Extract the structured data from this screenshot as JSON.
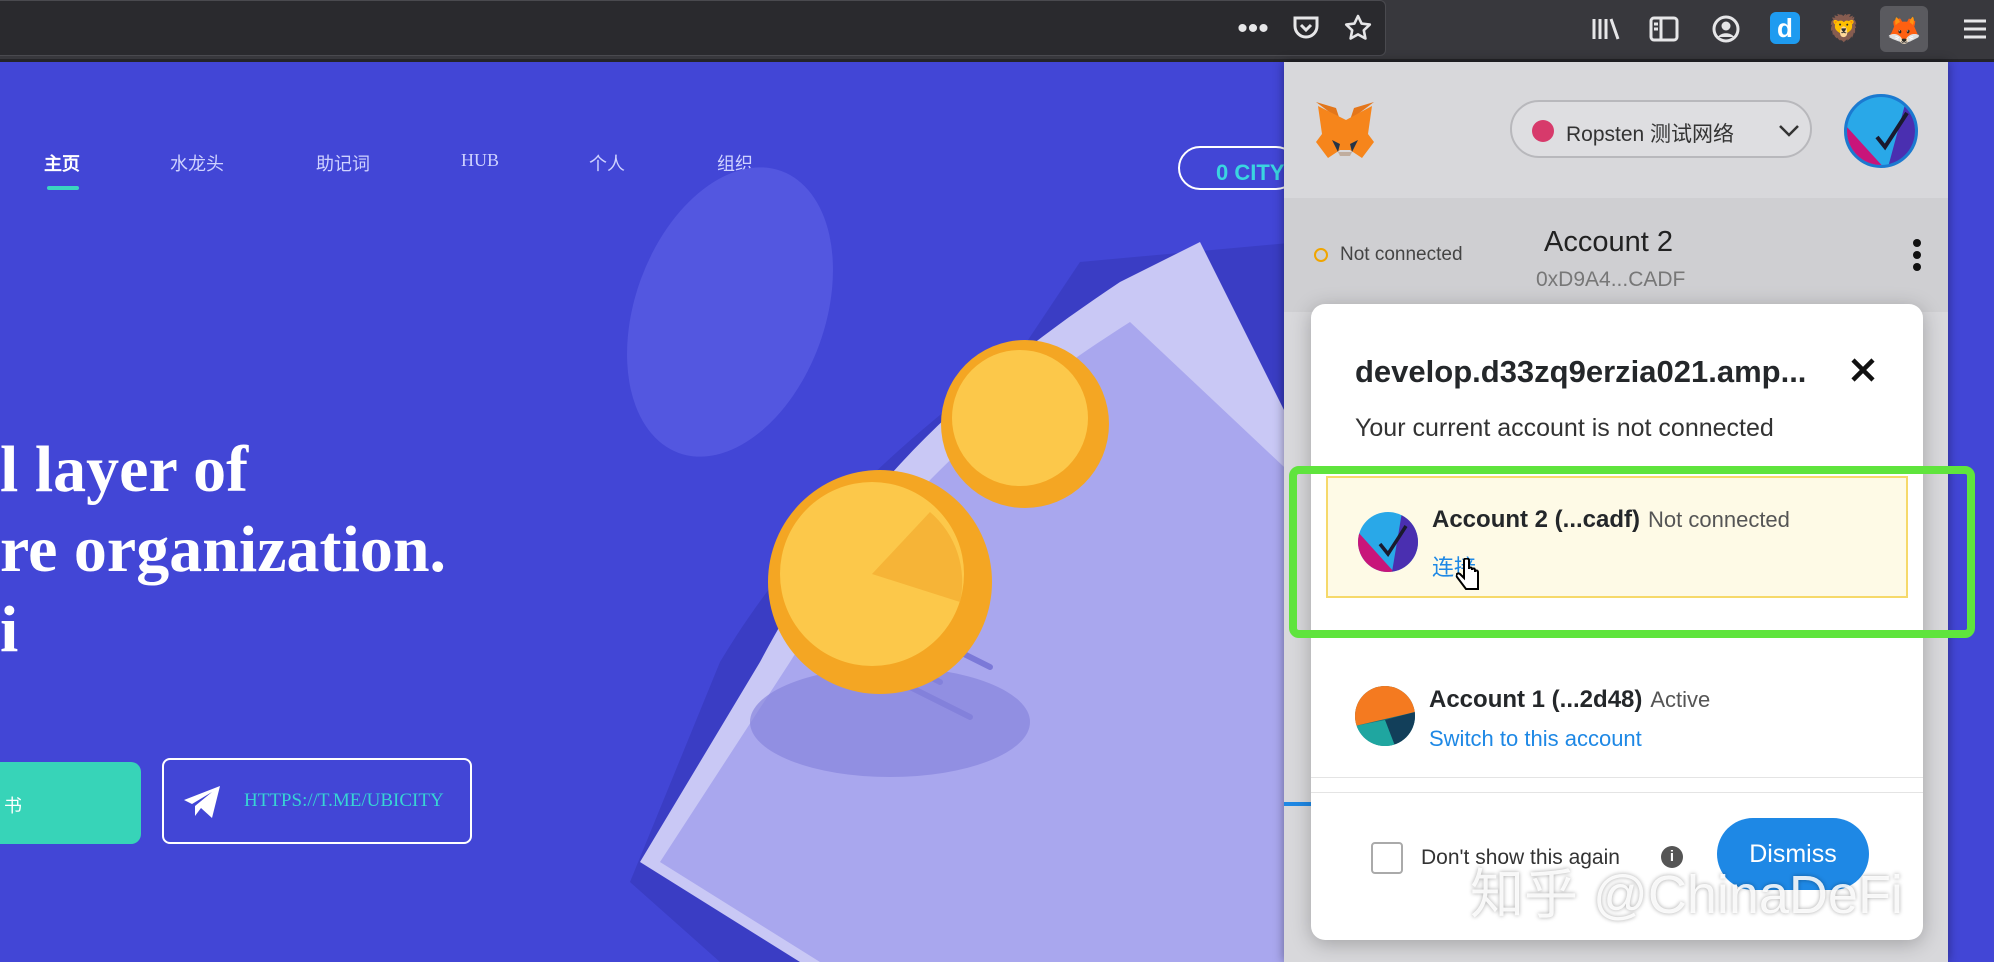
{
  "site": {
    "nav": [
      "主页",
      "水龙头",
      "助记词",
      "HUB",
      "个人",
      "组织"
    ],
    "city_button": "0 CITY",
    "hero_lines": [
      "l layer of",
      "re organization.",
      "i"
    ],
    "buttons": {
      "green_label": "书",
      "telegram_label": "HTTPS://T.ME/UBICITY"
    },
    "colors": {
      "background": "#4246d6",
      "accent": "#37d4b8"
    }
  },
  "metamask": {
    "network": "Ropsten 测试网络",
    "connection_status": "Not connected",
    "account_name": "Account 2",
    "account_address": "0xD9A4...CADF",
    "modal": {
      "site": "develop.d33zq9erzia021.amp...",
      "subtitle": "Your current account is not connected",
      "accounts": [
        {
          "name": "Account 2 (...cadf)",
          "status": "Not connected",
          "action": "连接"
        },
        {
          "name": "Account 1 (...2d48)",
          "status": "Active",
          "action": "Switch to this account"
        }
      ],
      "dont_show_label": "Don't show this again",
      "dismiss": "Dismiss"
    },
    "colors": {
      "highlight": "#5fe43d",
      "link": "#1e88e5",
      "dismiss": "#1e88e5"
    }
  },
  "watermark": "知乎 @ChinaDeFi"
}
